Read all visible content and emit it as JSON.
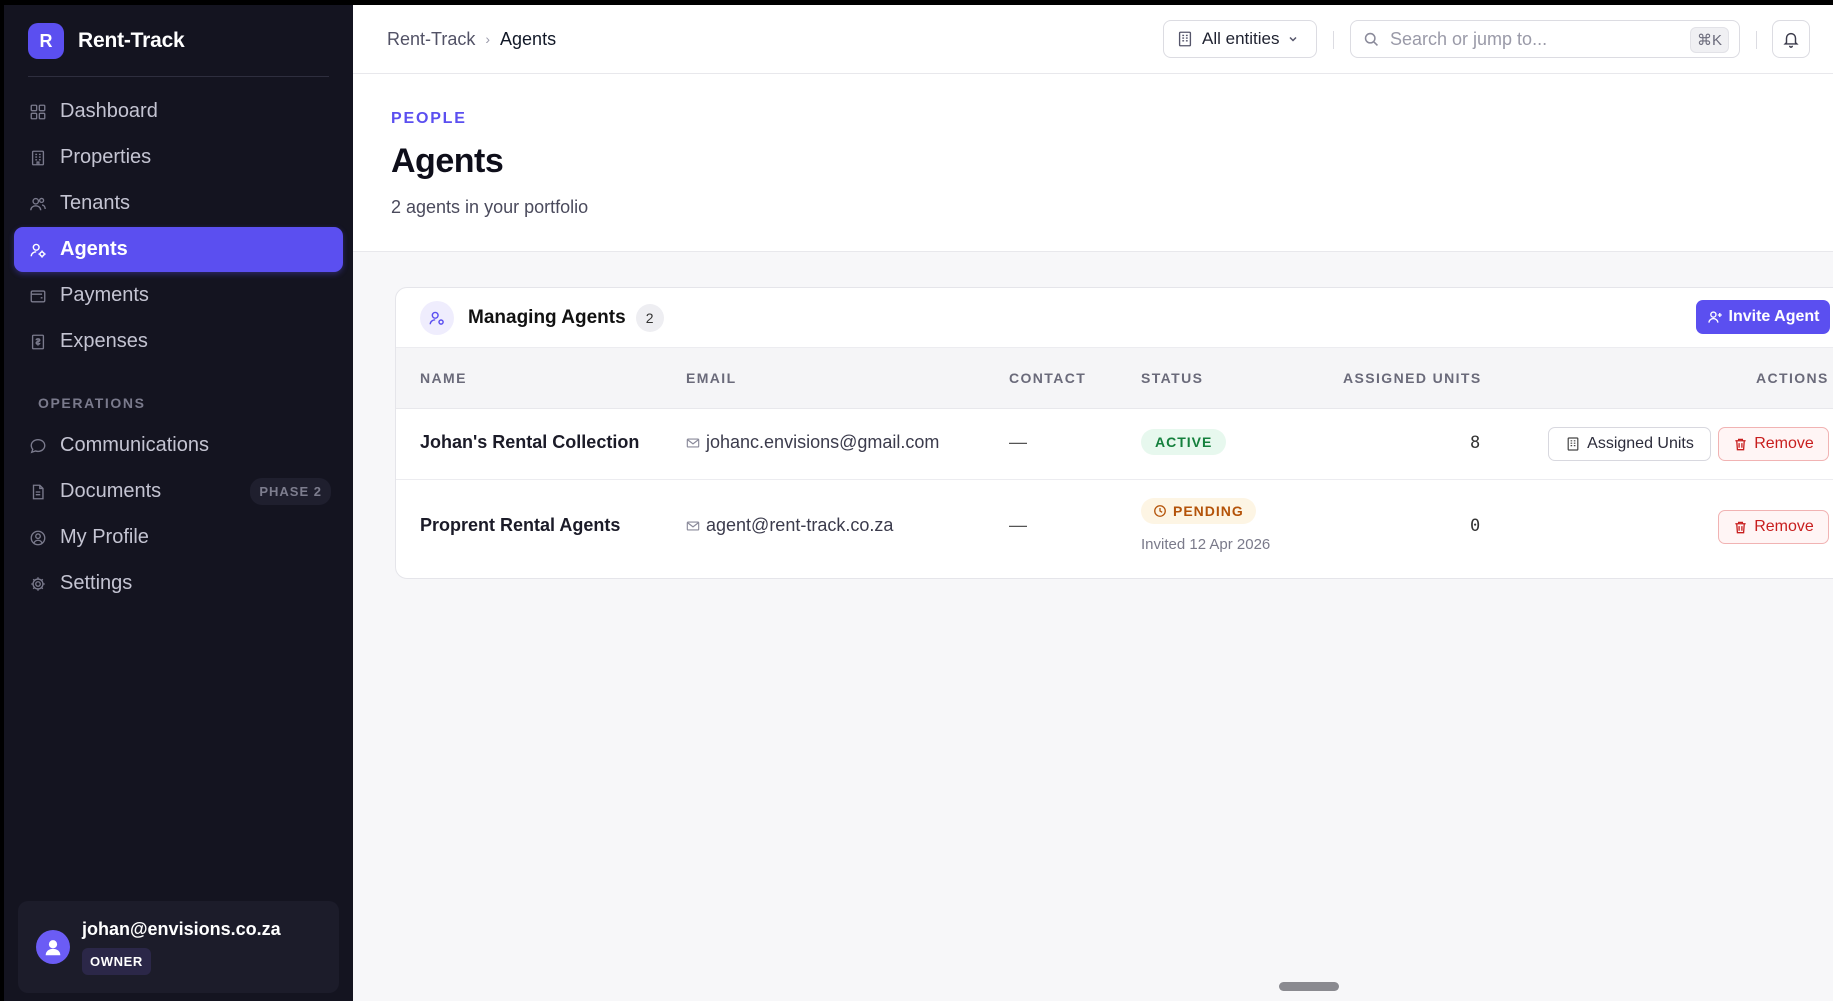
{
  "brand": {
    "logo_letter": "R",
    "name": "Rent-Track"
  },
  "sidebar": {
    "items": [
      {
        "label": "Dashboard",
        "icon": "dashboard-icon"
      },
      {
        "label": "Properties",
        "icon": "building-icon"
      },
      {
        "label": "Tenants",
        "icon": "users-icon"
      },
      {
        "label": "Agents",
        "icon": "agent-icon",
        "active": true
      },
      {
        "label": "Payments",
        "icon": "wallet-icon"
      },
      {
        "label": "Expenses",
        "icon": "receipt-icon"
      }
    ],
    "operations_label": "OPERATIONS",
    "operations": [
      {
        "label": "Communications",
        "icon": "chat-icon"
      },
      {
        "label": "Documents",
        "icon": "document-icon",
        "badge": "PHASE 2"
      },
      {
        "label": "My Profile",
        "icon": "profile-icon"
      },
      {
        "label": "Settings",
        "icon": "gear-icon"
      }
    ],
    "user": {
      "email": "johan@envisions.co.za",
      "role": "OWNER"
    }
  },
  "topbar": {
    "breadcrumb_root": "Rent-Track",
    "breadcrumb_current": "Agents",
    "entity_select": "All entities",
    "search_placeholder": "Search or jump to...",
    "shortcut": "⌘K"
  },
  "header": {
    "eyebrow": "PEOPLE",
    "title": "Agents",
    "subtitle": "2 agents in your portfolio"
  },
  "card": {
    "title": "Managing Agents",
    "count": "2",
    "invite_label": "Invite Agent",
    "columns": [
      "NAME",
      "EMAIL",
      "CONTACT",
      "STATUS",
      "ASSIGNED UNITS",
      "ACTIONS"
    ],
    "rows": [
      {
        "name": "Johan's Rental Collection",
        "email": "johanc.envisions@gmail.com",
        "contact": "—",
        "status": "ACTIVE",
        "units": "8",
        "assigned_label": "Assigned Units",
        "remove_label": "Remove"
      },
      {
        "name": "Proprent Rental Agents",
        "email": "agent@rent-track.co.za",
        "contact": "—",
        "status": "PENDING",
        "invited": "Invited 12 Apr 2026",
        "units": "0",
        "remove_label": "Remove"
      }
    ]
  },
  "colors": {
    "accent": "#5b4ff0",
    "sidebar_bg": "#141420",
    "active_green": "#15803d",
    "pending_amber": "#b45309",
    "danger": "#c81e1e"
  }
}
